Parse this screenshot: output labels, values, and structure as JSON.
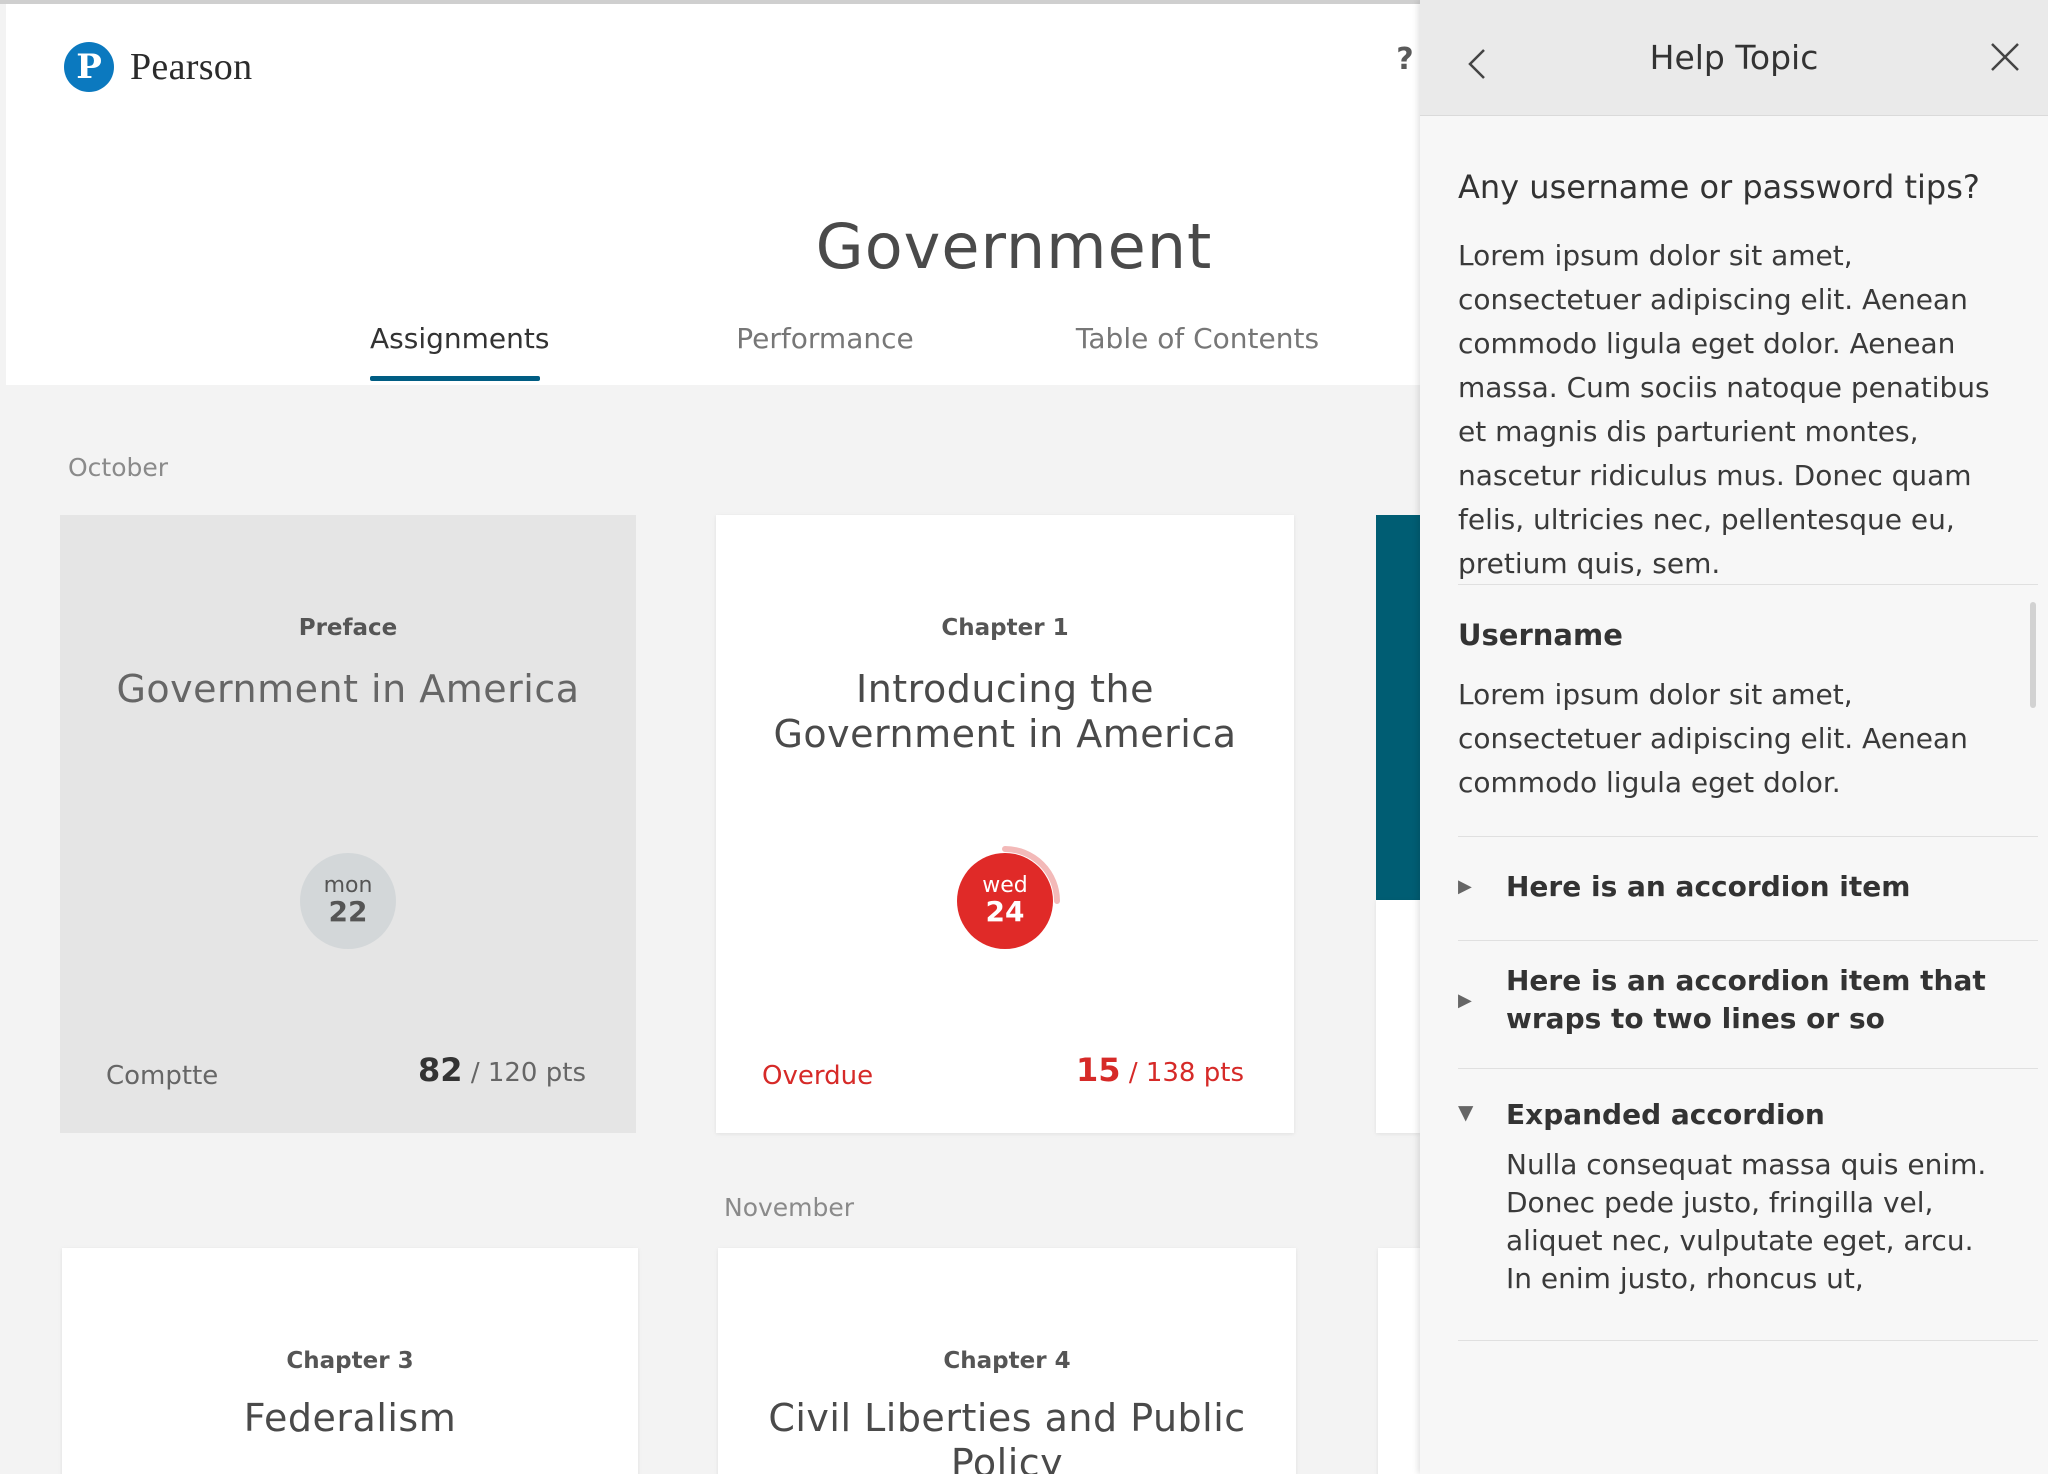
{
  "app": {
    "brand": "Pearson",
    "logo_letter": "P",
    "help_label": "?",
    "course_title": "Government",
    "tabs": [
      {
        "label": "Assignments",
        "active": true
      },
      {
        "label": "Performance",
        "active": false
      },
      {
        "label": "Table of Contents",
        "active": false
      }
    ],
    "months": [
      "October",
      "November"
    ],
    "cards": [
      {
        "chapter": "Preface",
        "title": "Government in America",
        "due_day": "mon",
        "due_date": "22",
        "status": "Comptte",
        "score": "82",
        "total": "/ 120 pts"
      },
      {
        "chapter": "Chapter 1",
        "title": "Introducing the Government in America",
        "due_day": "wed",
        "due_date": "24",
        "status": "Overdue",
        "score": "15",
        "total": "/ 138 pts",
        "progress_fraction": 0.25
      },
      {
        "chapter": "Chapter 3",
        "title": "Federalism"
      },
      {
        "chapter": "Chapter 4",
        "title": "Civil Liberties and Public Policy"
      }
    ]
  },
  "help_panel": {
    "title": "Help Topic",
    "question": "Any username or password tips?",
    "intro": "Lorem ipsum dolor sit amet, consectetuer adipiscing elit. Aenean commodo ligula eget dolor. Aenean massa. Cum sociis natoque penatibus et magnis dis parturient montes, nascetur ridiculus mus. Donec quam felis, ultricies nec, pellentesque eu, pretium quis, sem.",
    "username_heading": "Username",
    "username_text": "Lorem ipsum dolor sit amet, consectetuer adipiscing elit. Aenean commodo ligula eget dolor.",
    "accordion": [
      {
        "label": "Here is an accordion item",
        "expanded": false
      },
      {
        "label": "Here is an accordion item that wraps to two lines or so",
        "expanded": false
      },
      {
        "label": "Expanded accordion",
        "expanded": true,
        "content": "Nulla consequat massa quis enim. Donec pede justo, fringilla vel, aliquet nec, vulputate eget, arcu. In enim justo, rhoncus ut,"
      }
    ]
  },
  "colors": {
    "brand_blue": "#0b79bf",
    "tab_underline": "#005d83",
    "overdue_red": "#e02a28",
    "teal_card": "#005d73"
  },
  "icons": {
    "back": "chevron-left-icon",
    "close": "close-icon",
    "help": "question-icon",
    "accordion_collapsed": "triangle-right-icon",
    "accordion_expanded": "triangle-down-icon"
  }
}
